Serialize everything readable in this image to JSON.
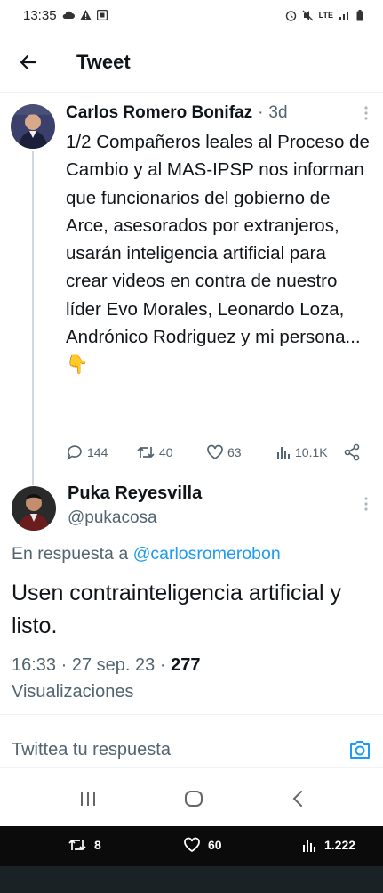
{
  "status_bar": {
    "time": "13:35",
    "network": "LTE"
  },
  "header": {
    "title": "Tweet"
  },
  "tweet": {
    "author_name": "Carlos Romero Bonifaz",
    "separator": "·",
    "time_ago": "3d",
    "text": "1/2 Compañeros leales al Proceso de Cambio y al MAS-IPSP nos informan que funcionarios del gobierno de Arce, asesorados por extranjeros, usarán inteligencia artificial para crear videos en contra de nuestro líder Evo Morales, Leonardo Loza, Andrónico Rodriguez y mi persona...👇",
    "replies": "144",
    "retweets": "40",
    "likes": "63",
    "views": "10.1K"
  },
  "reply": {
    "author_name": "Puka Reyesvilla",
    "handle": "@pukacosa",
    "reply_prefix": "En respuesta a",
    "reply_mention": "@carlosromerobon",
    "text": "Usen contrainteligencia artificial y listo.",
    "time": "16:33",
    "dot": "·",
    "date": "27 sep. 23",
    "views_count": "277",
    "views_label": "Visualizaciones"
  },
  "composer": {
    "placeholder": "Twittea tu respuesta"
  },
  "overlay": {
    "retweets": "8",
    "likes": "60",
    "views": "1.222"
  },
  "colors": {
    "accent": "#1d9bf0",
    "muted": "#536471",
    "text": "#0f1419"
  }
}
